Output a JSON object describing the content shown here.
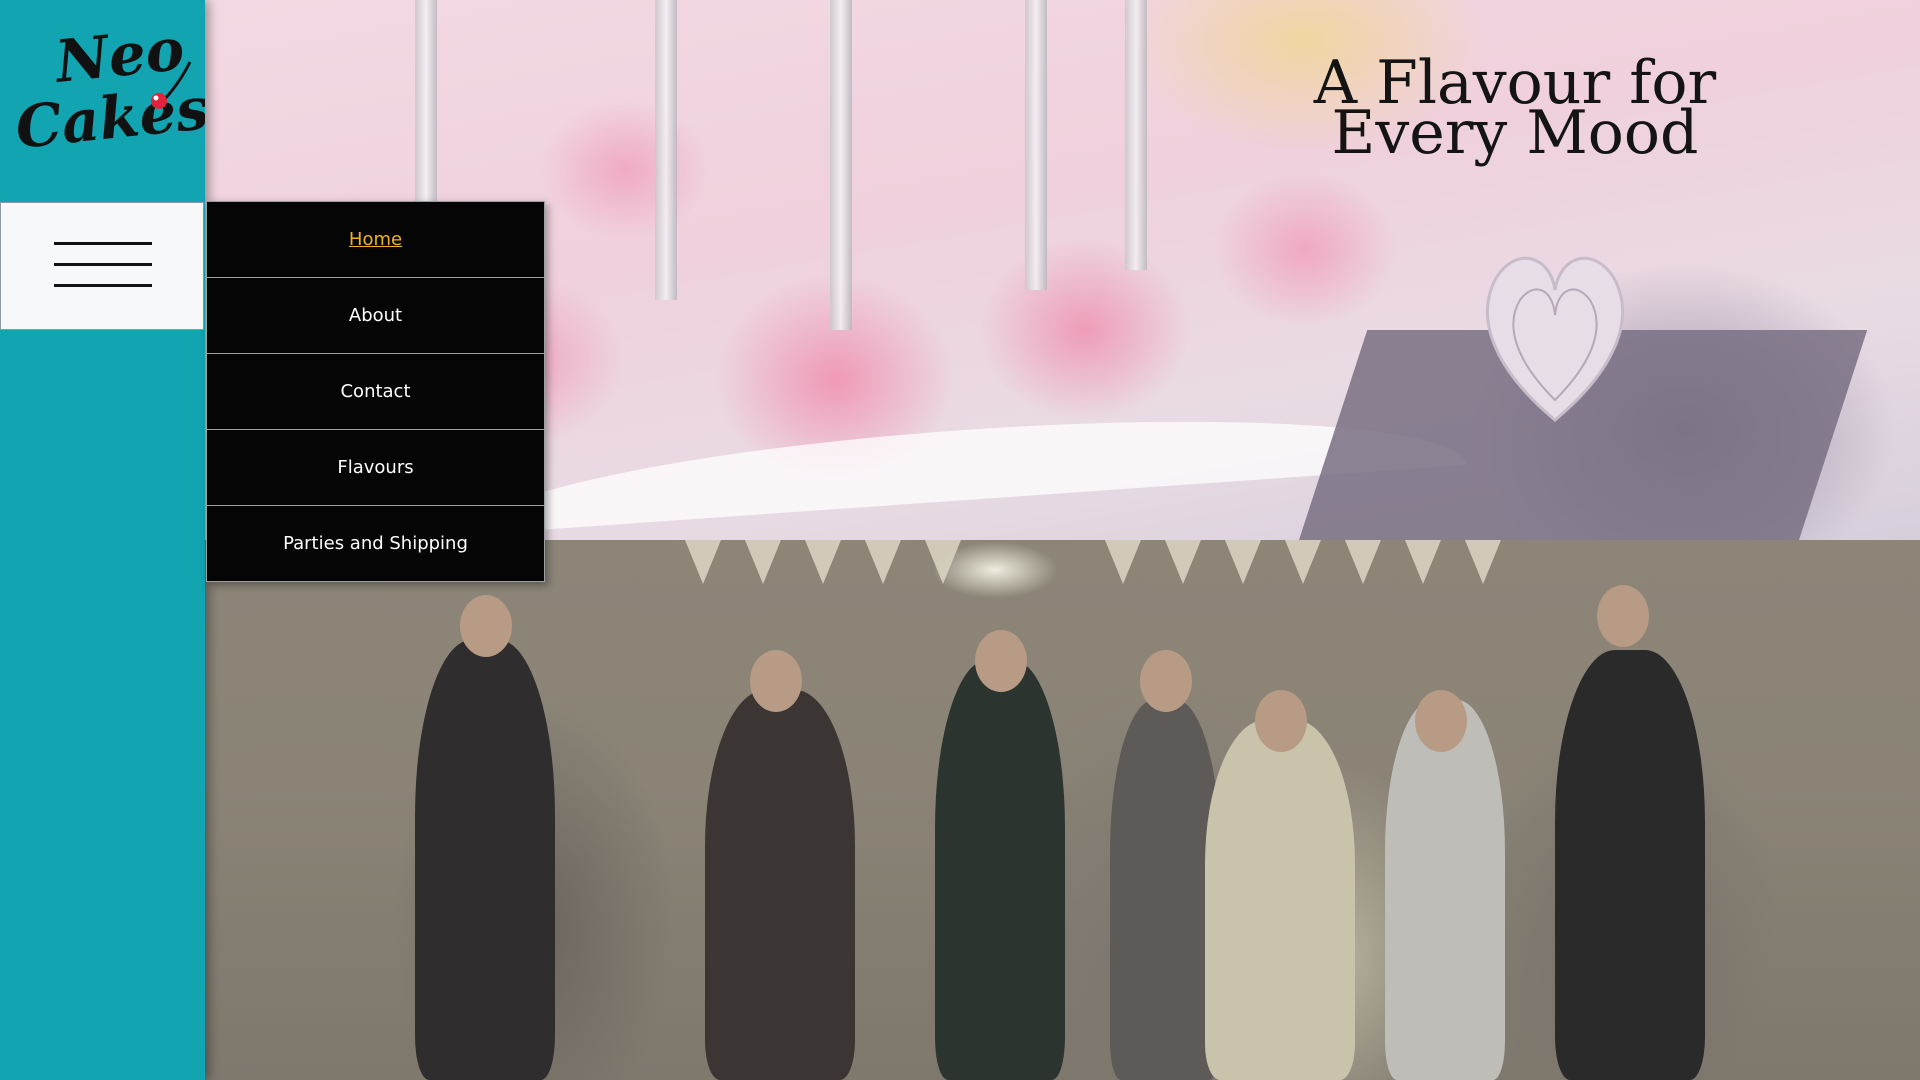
{
  "brand": {
    "logo_line1": "Neo",
    "logo_line2": "Cakes",
    "accent_color": "#12a4b1",
    "cherry_color": "#e0233a"
  },
  "menu_toggle": {
    "icon": "hamburger-icon"
  },
  "nav": {
    "items": [
      {
        "label": "Home",
        "active": true
      },
      {
        "label": "About",
        "active": false
      },
      {
        "label": "Contact",
        "active": false
      },
      {
        "label": "Flavours",
        "active": false
      },
      {
        "label": "Parties and Shipping",
        "active": false
      }
    ],
    "active_color": "#f2b21c",
    "background": "#050505"
  },
  "hero": {
    "title": "A Flavour for Every Mood"
  },
  "images": {
    "top": "cake-pops-photo",
    "bottom": "party-dancing-photo"
  }
}
